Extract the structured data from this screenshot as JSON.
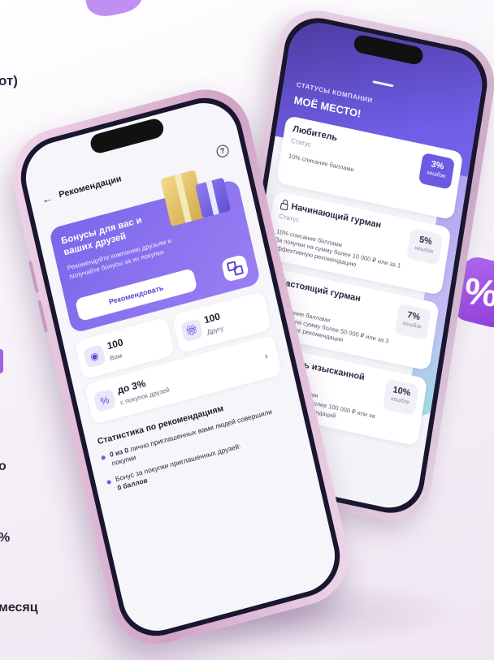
{
  "left_text": {
    "line1": "от)",
    "line2": "о",
    "line3": "%",
    "line4": "месяц"
  },
  "back_phone": {
    "header_subtitle": "СТАТУСЫ КОМПАНИИ",
    "header_title": "МОЁ МЕСТО!",
    "statuses": [
      {
        "name": "Любитель",
        "status": "Статус",
        "desc": "10% списание баллами",
        "percent": "3%",
        "cashback": "кешбэк",
        "locked": false,
        "active": true
      },
      {
        "name": "Начинающий гурман",
        "status": "Статус",
        "desc": "10% списание баллами\nЗа покупки на сумму более 10 000 ₽ или за 1 эффективную рекомендацию",
        "percent": "5%",
        "cashback": "кешбэк",
        "locked": true,
        "active": false
      },
      {
        "name": "Настоящий гурман",
        "status": "Статус",
        "desc": "20% списание баллами\nЗа покупки на сумму более 50 000 ₽ или за 3 эффективные рекомендации",
        "percent": "7%",
        "cashback": "кешбэк",
        "locked": true,
        "active": false
      },
      {
        "name": "Ценитель изысканной",
        "status": "Статус",
        "desc": "30% списание баллами\nЗа покупки на сумму более 100 000 ₽ или за 5 эффективных рекомендаций",
        "percent": "10%",
        "cashback": "кешбэк",
        "locked": true,
        "active": false
      }
    ]
  },
  "front_phone": {
    "nav_title": "Рекомендации",
    "back_icon": "arrow-left-icon",
    "help_icon": "question-icon",
    "promo": {
      "title": "Бонусы для вас и ваших друзей",
      "description": "Рекомендуйте компанию друзьям и получайте бонусы за их покупки",
      "button_label": "Рекомендовать",
      "qr_icon": "qr-code-icon"
    },
    "bonus_you": {
      "value": "100",
      "label": "Вам",
      "icon": "coin-icon"
    },
    "bonus_friend": {
      "value": "100",
      "label": "Другу",
      "icon": "gift-icon"
    },
    "friends_cashback": {
      "value": "до 3%",
      "label": "с покупок друзей",
      "icon": "percent-icon"
    },
    "stats_title": "Статистика по рекомендациям",
    "stats": [
      {
        "bold": "0 из 0",
        "text": " лично приглашенных вами людей совершили покупки"
      },
      {
        "bold": "",
        "text": "Бонус за покупки приглашенных друзей:",
        "bold_after": "0 баллов"
      }
    ]
  },
  "colors": {
    "accent": "#6b5ae2",
    "header_dark": "#4c3aa0",
    "phone_frame": "#cfa3c6",
    "blob": "#b46bf0"
  }
}
